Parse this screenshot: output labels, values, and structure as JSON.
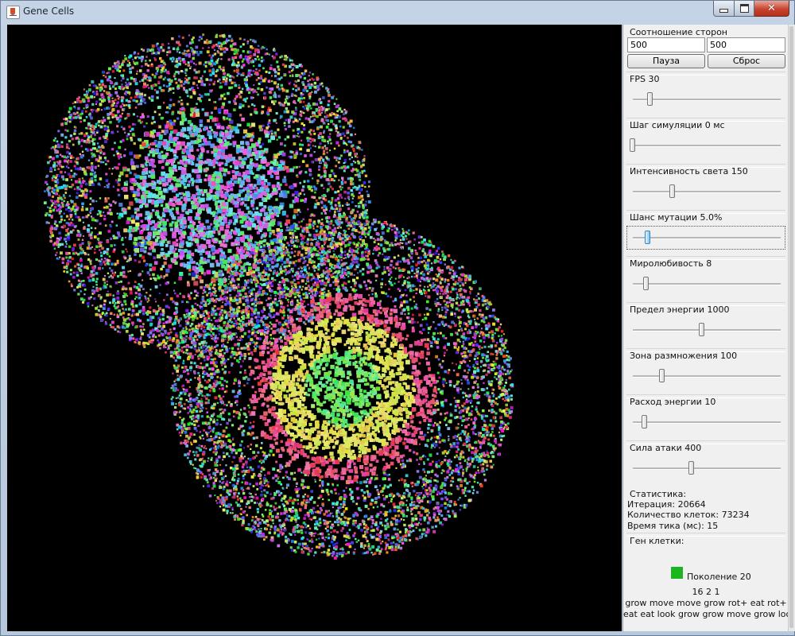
{
  "window": {
    "title": "Gene Cells"
  },
  "colors": {
    "gene_swatch": "#1bb61f",
    "canvas_background": "#000000",
    "active_slider_knob": "#7ec4ef"
  },
  "icons": {
    "app": "java-app-icon",
    "minimize": "minimize-icon",
    "maximize": "maximize-icon",
    "close": "close-icon"
  },
  "panel": {
    "aspect_label": "Соотношение сторон",
    "aspect_width": "500",
    "aspect_height": "500",
    "pause_label": "Пауза",
    "reset_label": "Сброс",
    "sliders": [
      {
        "label": "FPS 30",
        "value": 30,
        "position": 0.12
      },
      {
        "label": "Шаг симуляции 0 мс",
        "value": 0,
        "position": 0.0
      },
      {
        "label": "Интенсивность света 150",
        "value": 150,
        "position": 0.27
      },
      {
        "label": "Шанс мутации 5.0%",
        "value": 5.0,
        "position": 0.1,
        "focused": true
      },
      {
        "label": "Миролюбивость 8",
        "value": 8,
        "position": 0.09
      },
      {
        "label": "Предел энергии 1000",
        "value": 1000,
        "position": 0.47
      },
      {
        "label": "Зона размножения 100",
        "value": 100,
        "position": 0.2
      },
      {
        "label": "Расход энергии 10",
        "value": 10,
        "position": 0.08
      },
      {
        "label": "Сила атаки 400",
        "value": 400,
        "position": 0.4
      }
    ],
    "stats": {
      "title": "Статистика:",
      "iteration": "Итерация: 20664",
      "cell_count": "Количество клеток: 73234",
      "tick_time": "Время тика (мс): 15"
    },
    "gene": {
      "title": "Ген клетки:",
      "generation": "Поколение 20",
      "numbers": "16 2 1",
      "line1": "grow move move grow rot+ eat rot+",
      "line2": "eat eat look grow grow move grow look"
    }
  }
}
